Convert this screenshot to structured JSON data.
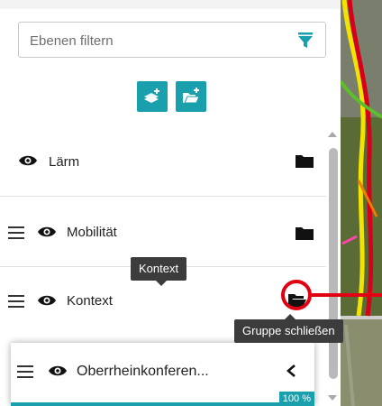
{
  "filter": {
    "placeholder": "Ebenen filtern",
    "icon": "filter-icon"
  },
  "toolbar": {
    "add_layer_icon": "add-layer-icon",
    "add_folder_icon": "add-folder-icon"
  },
  "layers": [
    {
      "label": "Lärm",
      "drag": false,
      "folder": "closed"
    },
    {
      "label": "Mobilität",
      "drag": true,
      "folder": "closed"
    },
    {
      "label": "Kontext",
      "drag": true,
      "folder": "open"
    }
  ],
  "floating_item": {
    "label": "Oberrheinkonferen...",
    "progress_label": "100 %",
    "progress_percent": 100
  },
  "tooltips": {
    "context": "Kontext",
    "close_group": "Gruppe schließen"
  },
  "colors": {
    "accent": "#1aa0ad",
    "highlight": "#e00012",
    "tooltip_bg": "#3c3c3c"
  }
}
